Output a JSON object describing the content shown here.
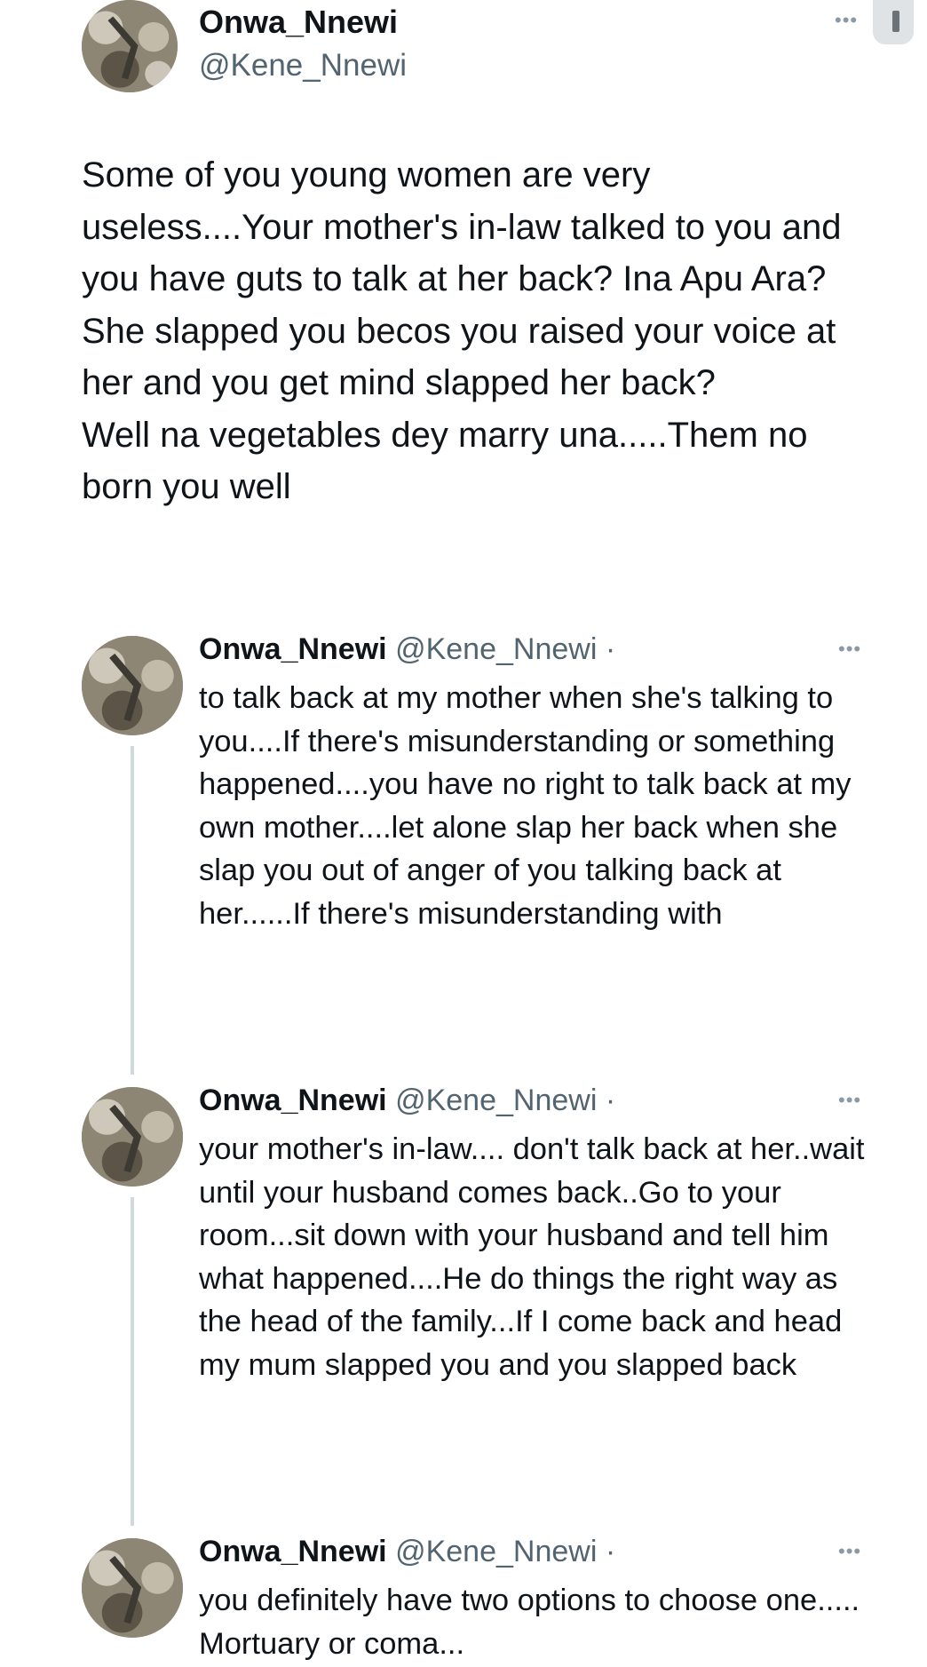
{
  "main_tweet": {
    "display_name": "Onwa_Nnewi",
    "handle": "@Kene_Nnewi",
    "text": "Some of you young women are very useless....Your mother's in-law talked to you and you have guts to talk at her back? Ina Apu Ara? She slapped you becos you raised your voice at her and you get mind slapped her back?\nWell na vegetables dey marry una.....Them no born you well"
  },
  "replies": [
    {
      "display_name": "Onwa_Nnewi",
      "handle": "@Kene_Nnewi",
      "separator": "·",
      "text": "to talk back at my mother when she's talking to you....If there's misunderstanding or something happened....you have no right to talk back at my own mother....let alone slap her back when she slap you out of anger of you talking back at her......If there's misunderstanding with"
    },
    {
      "display_name": "Onwa_Nnewi",
      "handle": "@Kene_Nnewi",
      "separator": "·",
      "text": "your mother's in-law.... don't talk back at her..wait until your husband comes back..Go to your room...sit down with your husband and tell him what happened....He do things the right way as the head of the family...If I come back and head my mum slapped you and you slapped back"
    },
    {
      "display_name": "Onwa_Nnewi",
      "handle": "@Kene_Nnewi",
      "separator": "·",
      "text": "you definitely have two options to choose one..... Mortuary or coma..."
    }
  ],
  "icons": {
    "more": "more-horizontal-icon"
  },
  "colors": {
    "text": "#0f1419",
    "secondary": "#536471",
    "thread_line": "#cfd9de"
  }
}
